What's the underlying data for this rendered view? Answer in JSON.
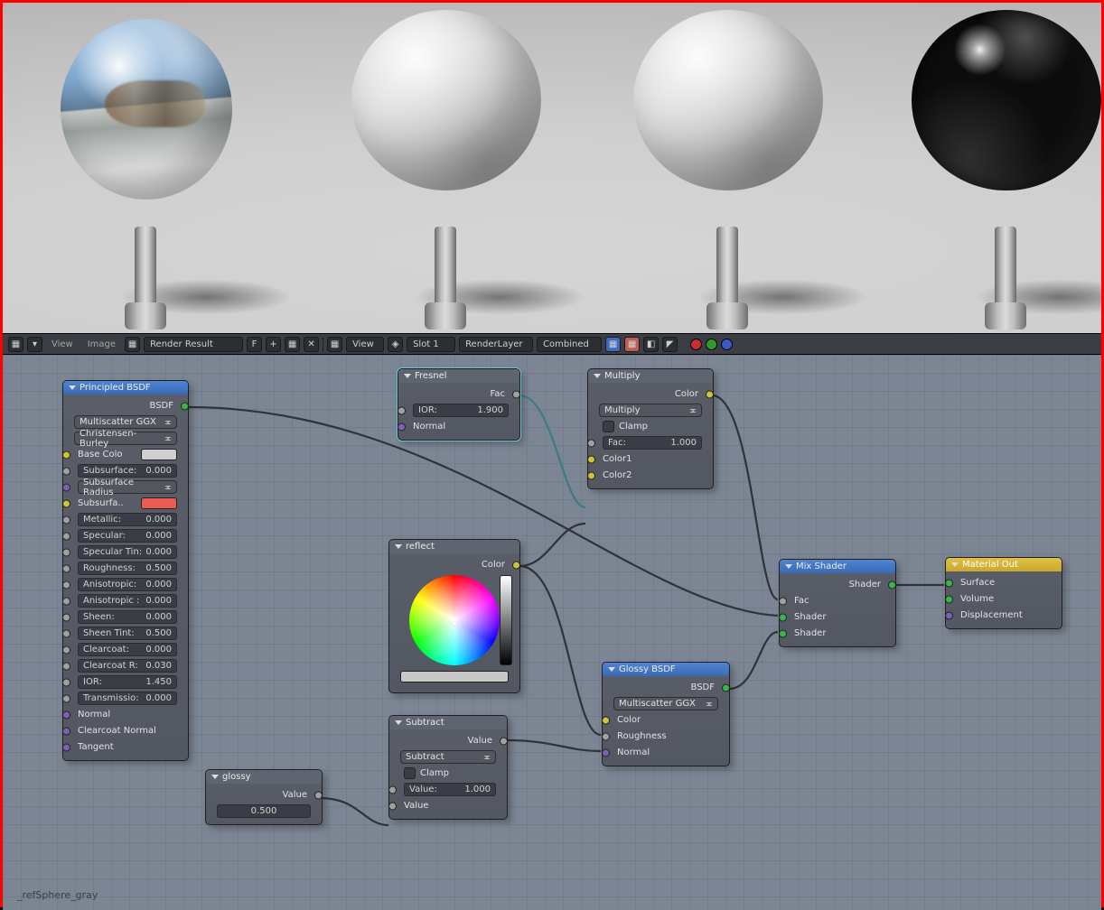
{
  "toolbar": {
    "view": "View",
    "image": "Image",
    "render_result": "Render Result",
    "f": "F",
    "view2": "View",
    "slot": "Slot 1",
    "layer": "RenderLayer",
    "pass": "Combined"
  },
  "material_name": "_refSphere_gray",
  "nodes": {
    "principled": {
      "title": "Principled BSDF",
      "out_bsdf": "BSDF",
      "dist": "Multiscatter GGX",
      "sss_method": "Christensen-Burley",
      "base_color_label": "Base Colo",
      "subsurface": {
        "label": "Subsurface:",
        "value": "0.000"
      },
      "sss_radius": "Subsurface Radius",
      "sss_color_label": "Subsurfa..",
      "metallic": {
        "label": "Metallic:",
        "value": "0.000"
      },
      "specular": {
        "label": "Specular:",
        "value": "0.000"
      },
      "spec_tint": {
        "label": "Specular Tin:",
        "value": "0.000"
      },
      "roughness": {
        "label": "Roughness:",
        "value": "0.500"
      },
      "anisotropic": {
        "label": "Anisotropic:",
        "value": "0.000"
      },
      "aniso_rot": {
        "label": "Anisotropic :",
        "value": "0.000"
      },
      "sheen": {
        "label": "Sheen:",
        "value": "0.000"
      },
      "sheen_tint": {
        "label": "Sheen Tint:",
        "value": "0.500"
      },
      "clearcoat": {
        "label": "Clearcoat:",
        "value": "0.000"
      },
      "cc_rough": {
        "label": "Clearcoat R:",
        "value": "0.030"
      },
      "ior": {
        "label": "IOR:",
        "value": "1.450"
      },
      "transmission": {
        "label": "Transmissio:",
        "value": "0.000"
      },
      "normal": "Normal",
      "cc_normal": "Clearcoat Normal",
      "tangent": "Tangent"
    },
    "glossy_value": {
      "title": "glossy",
      "out": "Value",
      "value": "0.500"
    },
    "fresnel": {
      "title": "Fresnel",
      "out": "Fac",
      "ior": {
        "label": "IOR:",
        "value": "1.900"
      },
      "normal": "Normal"
    },
    "reflect": {
      "title": "reflect",
      "out": "Color"
    },
    "subtract": {
      "title": "Subtract",
      "out": "Value",
      "op": "Subtract",
      "clamp": "Clamp",
      "val1": {
        "label": "Value:",
        "value": "1.000"
      },
      "val2": "Value"
    },
    "multiply": {
      "title": "Multiply",
      "out": "Color",
      "op": "Multiply",
      "clamp": "Clamp",
      "fac": {
        "label": "Fac:",
        "value": "1.000"
      },
      "color1": "Color1",
      "color2": "Color2"
    },
    "glossy_bsdf": {
      "title": "Glossy BSDF",
      "out": "BSDF",
      "dist": "Multiscatter GGX",
      "color": "Color",
      "roughness": "Roughness",
      "normal": "Normal"
    },
    "mix_shader": {
      "title": "Mix Shader",
      "out": "Shader",
      "fac": "Fac",
      "shader1": "Shader",
      "shader2": "Shader"
    },
    "material_out": {
      "title": "Material Out",
      "surface": "Surface",
      "volume": "Volume",
      "displacement": "Displacement"
    }
  }
}
